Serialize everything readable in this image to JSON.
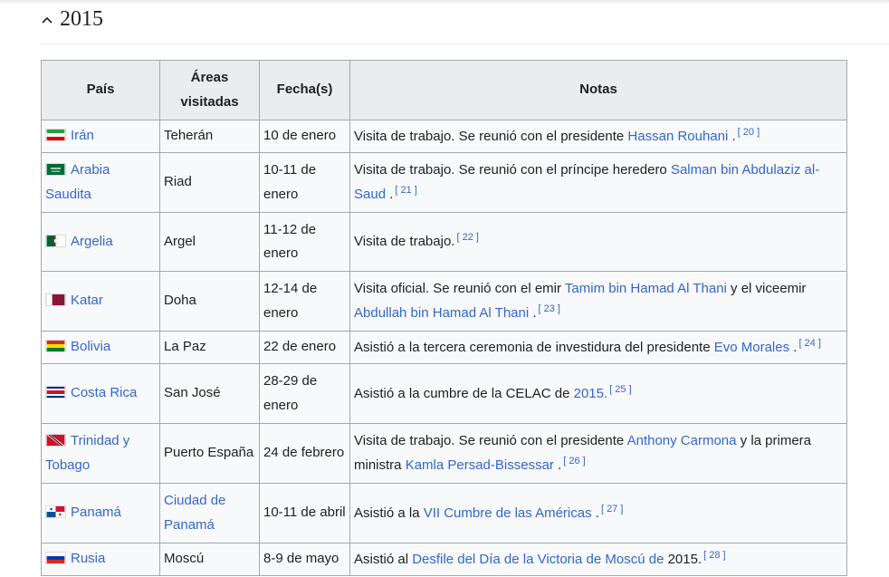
{
  "section": {
    "title": "2015",
    "toggle_icon": "chevron-up-icon"
  },
  "table": {
    "headers": {
      "country": "País",
      "areas": "Áreas visitadas",
      "date": "Fecha(s)",
      "notes": "Notas"
    },
    "rows": [
      {
        "country": "Irán",
        "flag": "iran-flag-icon",
        "area": "Teherán",
        "date": "10 de enero",
        "notes": [
          {
            "t": "Visita de trabajo. Se reunió con el presidente "
          },
          {
            "t": "Hassan Rouhani",
            "link": true
          },
          {
            "t": " ."
          },
          {
            "t": "[ 20 ]",
            "ref": true
          }
        ]
      },
      {
        "country": "Arabia Saudita",
        "flag": "saudi-arabia-flag-icon",
        "area": "Riad",
        "date": "10-11 de enero",
        "notes": [
          {
            "t": "Visita de trabajo. Se reunió con el príncipe heredero "
          },
          {
            "t": "Salman bin Abdulaziz al-Saud",
            "link": true
          },
          {
            "t": " ."
          },
          {
            "t": "[ 21 ]",
            "ref": true
          }
        ]
      },
      {
        "country": "Argelia",
        "flag": "algeria-flag-icon",
        "area": "Argel",
        "date": "11-12 de enero",
        "notes": [
          {
            "t": "Visita de trabajo."
          },
          {
            "t": "[ 22 ]",
            "ref": true
          }
        ]
      },
      {
        "country": "Katar",
        "flag": "qatar-flag-icon",
        "area": "Doha",
        "date": "12-14 de enero",
        "notes": [
          {
            "t": "Visita oficial. Se reunió con el emir "
          },
          {
            "t": "Tamim bin Hamad Al Thani",
            "link": true
          },
          {
            "t": " y el viceemir "
          },
          {
            "t": "Abdullah bin Hamad Al Thani",
            "link": true
          },
          {
            "t": " ."
          },
          {
            "t": "[ 23 ]",
            "ref": true
          }
        ]
      },
      {
        "country": "Bolivia",
        "flag": "bolivia-flag-icon",
        "area": "La Paz",
        "date": "22 de enero",
        "notes": [
          {
            "t": "Asistió a la tercera ceremonia de investidura del presidente "
          },
          {
            "t": "Evo Morales",
            "link": true
          },
          {
            "t": " ."
          },
          {
            "t": "[ 24 ]",
            "ref": true
          }
        ]
      },
      {
        "country": "Costa Rica",
        "flag": "costa-rica-flag-icon",
        "area": "San José",
        "date": "28-29 de enero",
        "notes": [
          {
            "t": "Asistió a la cumbre de la CELAC de "
          },
          {
            "t": "2015.",
            "link": true
          },
          {
            "t": "[ 25 ]",
            "ref": true
          }
        ]
      },
      {
        "country": "Trinidad y Tobago",
        "flag": "trinidad-tobago-flag-icon",
        "area": "Puerto España",
        "date": "24 de febrero",
        "notes": [
          {
            "t": "Visita de trabajo. Se reunió con el presidente "
          },
          {
            "t": "Anthony Carmona",
            "link": true
          },
          {
            "t": " y la primera ministra "
          },
          {
            "t": "Kamla Persad-Bissessar",
            "link": true
          },
          {
            "t": " ."
          },
          {
            "t": "[ 26 ]",
            "ref": true
          }
        ]
      },
      {
        "country": "Panamá",
        "flag": "panama-flag-icon",
        "area": "Ciudad de Panamá",
        "area_link": true,
        "date": "10-11 de abril",
        "notes": [
          {
            "t": "Asistió a la "
          },
          {
            "t": "VII Cumbre de las Américas",
            "link": true
          },
          {
            "t": " ."
          },
          {
            "t": "[ 27 ]",
            "ref": true
          }
        ]
      },
      {
        "country": "Rusia",
        "flag": "russia-flag-icon",
        "area": "Moscú",
        "date": "8-9 de mayo",
        "notes": [
          {
            "t": "Asistió al "
          },
          {
            "t": "Desfile del Día de la Victoria de Moscú de",
            "link": true
          },
          {
            "t": " 2015."
          },
          {
            "t": "[ 28 ]",
            "ref": true
          }
        ]
      }
    ]
  },
  "colors": {
    "link": "#3366cc",
    "header_bg": "#eaecf0",
    "cell_bg": "#f8f9fa",
    "border": "#a2a9b1"
  }
}
